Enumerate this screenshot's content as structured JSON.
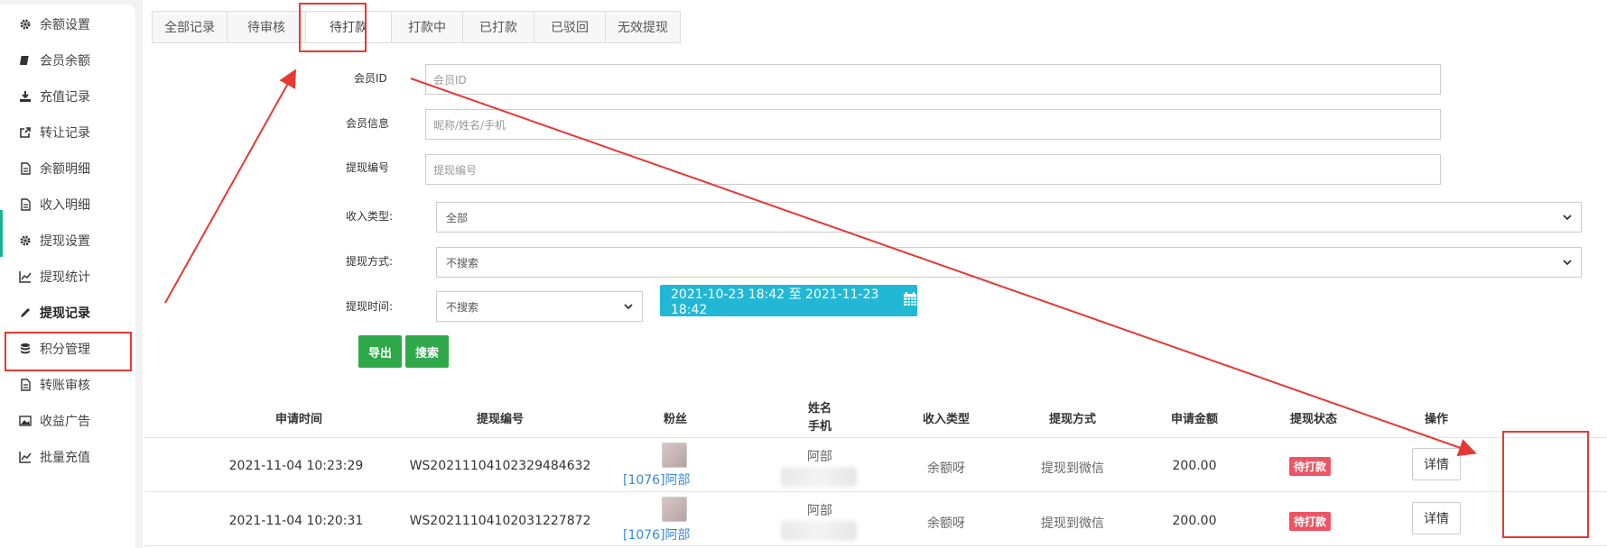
{
  "sidebar": {
    "items": [
      {
        "label": "余额设置",
        "icon": "gear-icon"
      },
      {
        "label": "会员余额",
        "icon": "book-icon"
      },
      {
        "label": "充值记录",
        "icon": "download-icon"
      },
      {
        "label": "转让记录",
        "icon": "external-link-icon"
      },
      {
        "label": "余额明细",
        "icon": "document-icon"
      },
      {
        "label": "收入明细",
        "icon": "document-icon"
      },
      {
        "label": "提现设置",
        "icon": "gear-icon"
      },
      {
        "label": "提现统计",
        "icon": "line-chart-icon"
      },
      {
        "label": "提现记录",
        "icon": "pencil-icon",
        "active": true
      },
      {
        "label": "积分管理",
        "icon": "database-icon"
      },
      {
        "label": "转账审核",
        "icon": "document-icon"
      },
      {
        "label": "收益广告",
        "icon": "image-icon"
      },
      {
        "label": "批量充值",
        "icon": "line-chart-icon"
      }
    ]
  },
  "tabs": [
    {
      "label": "全部记录"
    },
    {
      "label": "待审核"
    },
    {
      "label": "待打款",
      "active": true
    },
    {
      "label": "打款中"
    },
    {
      "label": "已打款"
    },
    {
      "label": "已驳回"
    },
    {
      "label": "无效提现"
    }
  ],
  "filters": {
    "member_id": {
      "label": "会员ID",
      "placeholder": "会员ID"
    },
    "member_info": {
      "label": "会员信息",
      "placeholder": "昵称/姓名/手机"
    },
    "withdraw_no": {
      "label": "提现编号",
      "placeholder": "提现编号"
    },
    "income_type": {
      "label": "收入类型:",
      "value": "全部"
    },
    "withdraw_method": {
      "label": "提现方式:",
      "value": "不搜索"
    },
    "withdraw_time": {
      "label": "提现时间:",
      "value": "不搜索"
    },
    "date_range": "2021-10-23 18:42 至 2021-11-23 18:42"
  },
  "buttons": {
    "export": "导出",
    "search": "搜索"
  },
  "table": {
    "headers": [
      "申请时间",
      "提现编号",
      "粉丝",
      "姓名",
      "手机",
      "收入类型",
      "提现方式",
      "申请金额",
      "提现状态",
      "操作"
    ],
    "rows": [
      {
        "time": "2021-11-04 10:23:29",
        "no": "WS20211104102329484632",
        "fan": "[1076]阿部",
        "name": "阿部",
        "income_type": "余额呀",
        "method": "提现到微信",
        "amount": "200.00",
        "status": "待打款",
        "action": "详情"
      },
      {
        "time": "2021-11-04 10:20:31",
        "no": "WS20211104102031227872",
        "fan": "[1076]阿部",
        "name": "阿部",
        "income_type": "余额呀",
        "method": "提现到微信",
        "amount": "200.00",
        "status": "待打款",
        "action": "详情"
      }
    ]
  },
  "colors": {
    "accent_green": "#2fa84a",
    "date_button": "#23b7d6",
    "status_badge": "#ed5565",
    "annotation_red": "#e53935",
    "link": "#3b89d6"
  }
}
